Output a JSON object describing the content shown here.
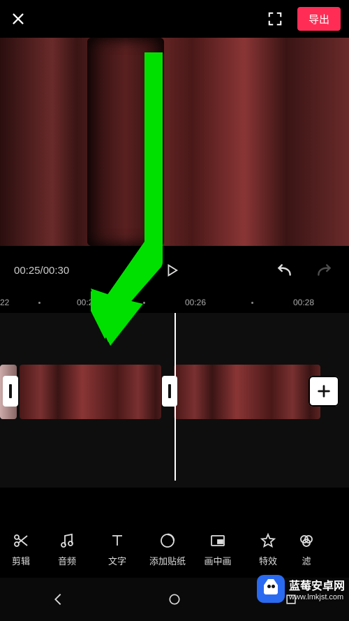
{
  "header": {
    "export_label": "导出"
  },
  "controls": {
    "time_display": "00:25/00:30"
  },
  "ruler": {
    "ticks": [
      "22",
      "00:24",
      "00:26",
      "00:28"
    ]
  },
  "toolbar": {
    "items": [
      {
        "label": "剪辑",
        "icon": "scissors-icon"
      },
      {
        "label": "音频",
        "icon": "music-icon"
      },
      {
        "label": "文字",
        "icon": "text-icon"
      },
      {
        "label": "添加贴纸",
        "icon": "sticker-icon"
      },
      {
        "label": "画中画",
        "icon": "pip-icon"
      },
      {
        "label": "特效",
        "icon": "star-icon"
      },
      {
        "label": "滤",
        "icon": "filter-icon"
      }
    ]
  },
  "watermark": {
    "title": "蓝莓安卓网",
    "url": "www.lmkjst.com"
  }
}
